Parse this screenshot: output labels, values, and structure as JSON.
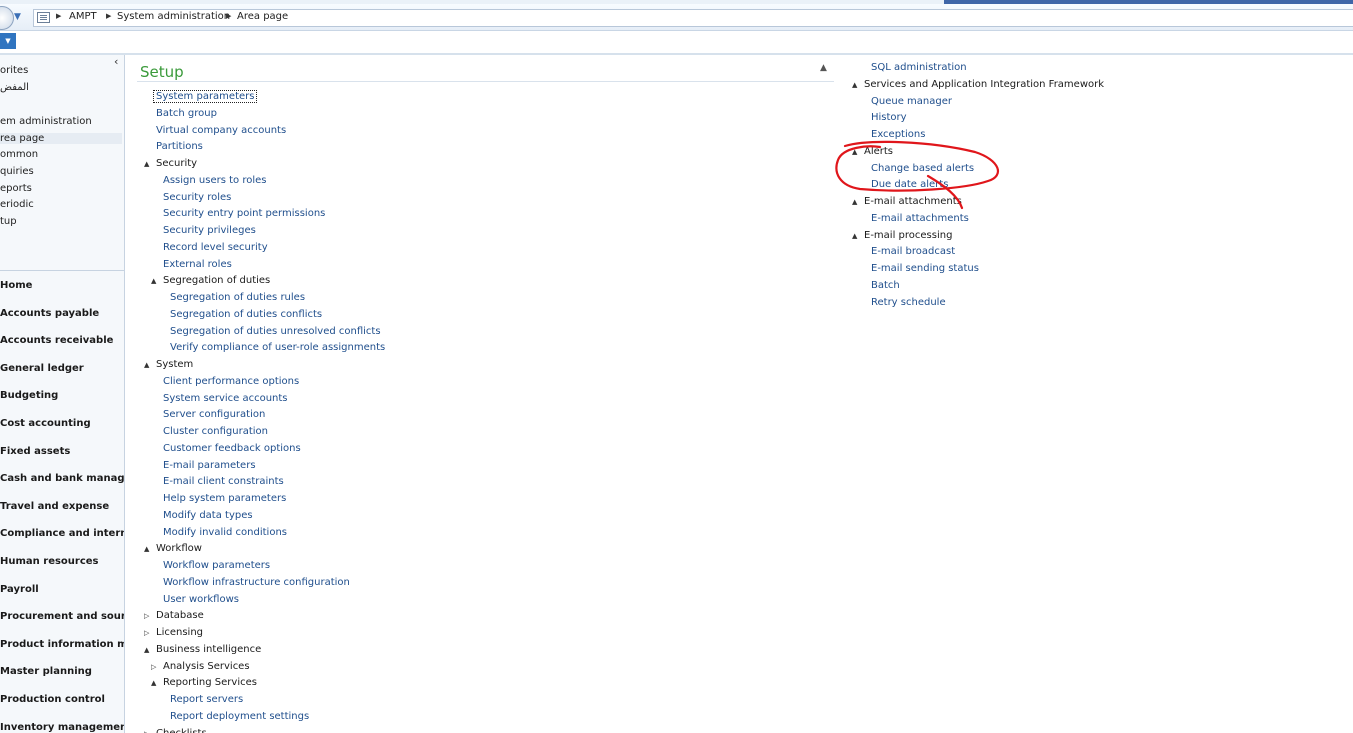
{
  "breadcrumb": [
    "AMPT",
    "System administration",
    "Area page"
  ],
  "area_items": [
    {
      "label": "orites",
      "selected": false
    },
    {
      "label": "المفض",
      "selected": false
    },
    {
      "label": "em administration",
      "selected": false
    },
    {
      "label": "rea page",
      "selected": true
    },
    {
      "label": "ommon",
      "selected": false
    },
    {
      "label": "quiries",
      "selected": false
    },
    {
      "label": "eports",
      "selected": false
    },
    {
      "label": "eriodic",
      "selected": false
    },
    {
      "label": "tup",
      "selected": false
    }
  ],
  "modules": [
    "Home",
    "Accounts payable",
    "Accounts receivable",
    "General ledger",
    "Budgeting",
    "Cost accounting",
    "Fixed assets",
    "Cash and bank manage...",
    "Travel and expense",
    "Compliance and internal...",
    "Human resources",
    "Payroll",
    "Procurement and sourci...",
    "Product information ma...",
    "Master planning",
    "Production control",
    "Inventory management"
  ],
  "section_title": "Setup",
  "left_tree": [
    {
      "label": "System parameters",
      "level": 0,
      "link": true,
      "focused": true
    },
    {
      "label": "Batch group",
      "level": 0,
      "link": true
    },
    {
      "label": "Virtual company accounts",
      "level": 0,
      "link": true
    },
    {
      "label": "Partitions",
      "level": 0,
      "link": true
    },
    {
      "label": "Security",
      "level": 0,
      "link": false,
      "toggle": "expanded"
    },
    {
      "label": "Assign users to roles",
      "level": 1,
      "link": true
    },
    {
      "label": "Security roles",
      "level": 1,
      "link": true
    },
    {
      "label": "Security entry point permissions",
      "level": 1,
      "link": true
    },
    {
      "label": "Security privileges",
      "level": 1,
      "link": true
    },
    {
      "label": "Record level security",
      "level": 1,
      "link": true
    },
    {
      "label": "External roles",
      "level": 1,
      "link": true
    },
    {
      "label": "Segregation of duties",
      "level": 1,
      "link": false,
      "toggle": "expanded"
    },
    {
      "label": "Segregation of duties rules",
      "level": 2,
      "link": true
    },
    {
      "label": "Segregation of duties conflicts",
      "level": 2,
      "link": true
    },
    {
      "label": "Segregation of duties unresolved conflicts",
      "level": 2,
      "link": true
    },
    {
      "label": "Verify compliance of user-role assignments",
      "level": 2,
      "link": true
    },
    {
      "label": "System",
      "level": 0,
      "link": false,
      "toggle": "expanded"
    },
    {
      "label": "Client performance options",
      "level": 1,
      "link": true
    },
    {
      "label": "System service accounts",
      "level": 1,
      "link": true
    },
    {
      "label": "Server configuration",
      "level": 1,
      "link": true
    },
    {
      "label": "Cluster configuration",
      "level": 1,
      "link": true
    },
    {
      "label": "Customer feedback options",
      "level": 1,
      "link": true
    },
    {
      "label": "E-mail parameters",
      "level": 1,
      "link": true
    },
    {
      "label": "E-mail client constraints",
      "level": 1,
      "link": true
    },
    {
      "label": "Help system parameters",
      "level": 1,
      "link": true
    },
    {
      "label": "Modify data types",
      "level": 1,
      "link": true
    },
    {
      "label": "Modify invalid conditions",
      "level": 1,
      "link": true
    },
    {
      "label": "Workflow",
      "level": 0,
      "link": false,
      "toggle": "expanded"
    },
    {
      "label": "Workflow parameters",
      "level": 1,
      "link": true
    },
    {
      "label": "Workflow infrastructure configuration",
      "level": 1,
      "link": true
    },
    {
      "label": "User workflows",
      "level": 1,
      "link": true
    },
    {
      "label": "Database",
      "level": 0,
      "link": false,
      "toggle": "collapsed"
    },
    {
      "label": "Licensing",
      "level": 0,
      "link": false,
      "toggle": "collapsed"
    },
    {
      "label": "Business intelligence",
      "level": 0,
      "link": false,
      "toggle": "expanded"
    },
    {
      "label": "Analysis Services",
      "level": 1,
      "link": false,
      "toggle": "collapsed"
    },
    {
      "label": "Reporting Services",
      "level": 1,
      "link": false,
      "toggle": "expanded"
    },
    {
      "label": "Report servers",
      "level": 2,
      "link": true
    },
    {
      "label": "Report deployment settings",
      "level": 2,
      "link": true
    },
    {
      "label": "Checklists",
      "level": 0,
      "link": false,
      "toggle": "collapsed"
    }
  ],
  "right_tree": [
    {
      "label": "SQL administration",
      "level": 1,
      "link": true
    },
    {
      "label": "Services and Application Integration Framework",
      "level": 0,
      "link": false,
      "toggle": "expanded"
    },
    {
      "label": "Queue manager",
      "level": 1,
      "link": true
    },
    {
      "label": "History",
      "level": 1,
      "link": true
    },
    {
      "label": "Exceptions",
      "level": 1,
      "link": true
    },
    {
      "label": "Alerts",
      "level": 0,
      "link": false,
      "toggle": "expanded"
    },
    {
      "label": "Change based alerts",
      "level": 1,
      "link": true
    },
    {
      "label": "Due date alerts",
      "level": 1,
      "link": true
    },
    {
      "label": "E-mail attachments",
      "level": 0,
      "link": false,
      "toggle": "expanded"
    },
    {
      "label": "E-mail attachments",
      "level": 1,
      "link": true
    },
    {
      "label": "E-mail processing",
      "level": 0,
      "link": false,
      "toggle": "expanded"
    },
    {
      "label": "E-mail broadcast",
      "level": 1,
      "link": true
    },
    {
      "label": "E-mail sending status",
      "level": 1,
      "link": true
    },
    {
      "label": "Batch",
      "level": 1,
      "link": true
    },
    {
      "label": "Retry schedule",
      "level": 1,
      "link": true
    }
  ],
  "colors": {
    "link": "#1f4e8c",
    "title_green": "#3a9a3a",
    "annotation_red": "#e0161b",
    "menu_blue": "#2f74c0"
  },
  "icons": {
    "expanded": "▲",
    "collapsed": "▷",
    "crumb_sep": "▶",
    "collapse_section": "▲",
    "nav_collapse": "‹"
  }
}
